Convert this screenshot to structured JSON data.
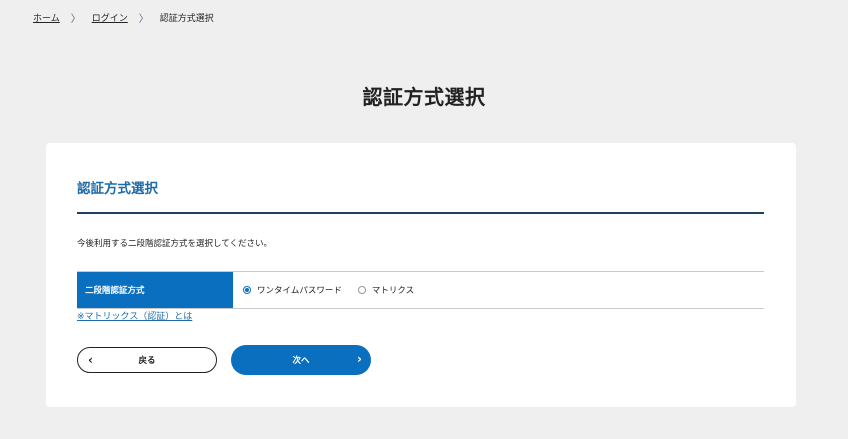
{
  "breadcrumb": {
    "home": "ホーム",
    "login": "ログイン",
    "current": "認証方式選択",
    "separator": "〉"
  },
  "page_title": "認証方式選択",
  "card": {
    "title": "認証方式選択",
    "instruction": "今後利用する二段階認証方式を選択してください。",
    "method_label": "二段階認証方式",
    "options": [
      {
        "label": "ワンタイムパスワード",
        "selected": true
      },
      {
        "label": "マトリクス",
        "selected": false
      }
    ],
    "help_link": "※マトリックス（認証）とは",
    "back_label": "戻る",
    "next_label": "次へ",
    "back_icon": "‹",
    "next_icon": "›"
  },
  "colors": {
    "accent": "#0b6fbf",
    "title_blue": "#1f6ba8",
    "rule": "#1e3f5e",
    "background": "#efefef"
  }
}
